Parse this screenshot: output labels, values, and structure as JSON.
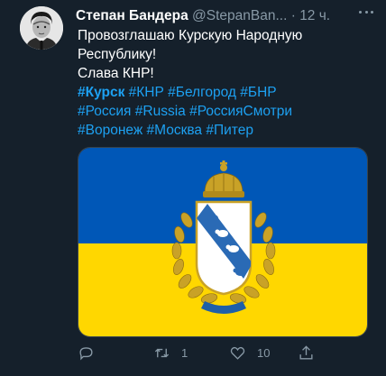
{
  "tweet": {
    "display_name": "Степан Бандера",
    "handle": "@StepanBan...",
    "separator": " · ",
    "time": "12 ч.",
    "text_line1": "Провозглашаю Курскую Народную",
    "text_line2": "Республику!",
    "text_line3": "Слава КНР!",
    "hashtags_line1": [
      "#Курск",
      "#КНР",
      "#Белгород",
      "#БНР"
    ],
    "hashtags_line2": [
      "#Россия",
      "#Russia",
      "#РоссияСмотри"
    ],
    "hashtags_line3": [
      "#Воронеж",
      "#Москва",
      "#Питер"
    ],
    "media": {
      "flag_top_color": "#0057b7",
      "flag_bottom_color": "#ffd700",
      "emblem": "Kursk coat of arms"
    },
    "actions": {
      "reply_count": "",
      "retweet_count": "1",
      "like_count": "10"
    },
    "icons": {
      "more": "more-dots-icon",
      "reply": "reply-icon",
      "retweet": "retweet-icon",
      "like": "heart-icon",
      "share": "share-icon"
    },
    "colors": {
      "background": "#15202b",
      "link": "#1da1f2",
      "muted": "#8899a6"
    }
  }
}
